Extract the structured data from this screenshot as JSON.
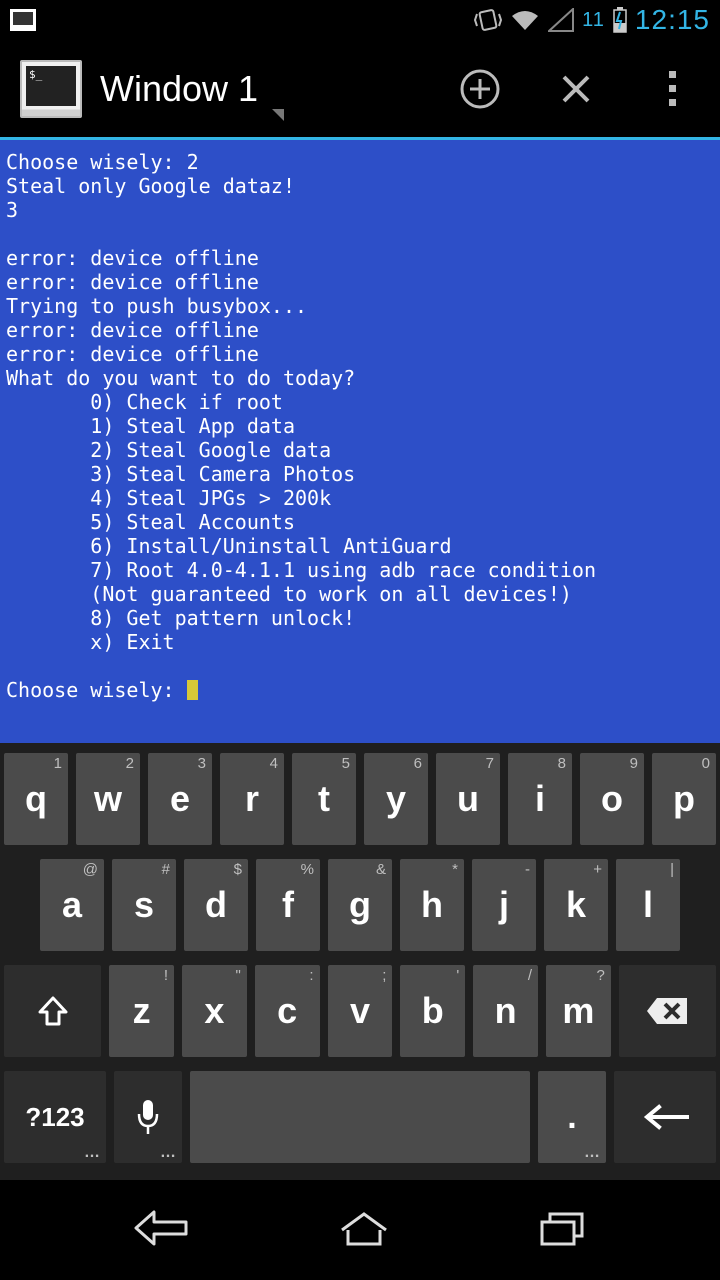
{
  "status": {
    "signal_text": "11",
    "time": "12:15"
  },
  "header": {
    "title": "Window 1"
  },
  "terminal": {
    "lines": [
      "Choose wisely: 2",
      "Steal only Google dataz!",
      "3",
      "",
      "error: device offline",
      "error: device offline",
      "Trying to push busybox...",
      "error: device offline",
      "error: device offline",
      "What do you want to do today?",
      "       0) Check if root",
      "       1) Steal App data",
      "       2) Steal Google data",
      "       3) Steal Camera Photos",
      "       4) Steal JPGs > 200k",
      "       5) Steal Accounts",
      "       6) Install/Uninstall AntiGuard",
      "       7) Root 4.0-4.1.1 using adb race condition",
      "       (Not guaranteed to work on all devices!)",
      "       8) Get pattern unlock!",
      "       x) Exit",
      ""
    ],
    "prompt": "Choose wisely: "
  },
  "keyboard": {
    "row1": [
      {
        "k": "q",
        "s": "1"
      },
      {
        "k": "w",
        "s": "2"
      },
      {
        "k": "e",
        "s": "3"
      },
      {
        "k": "r",
        "s": "4"
      },
      {
        "k": "t",
        "s": "5"
      },
      {
        "k": "y",
        "s": "6"
      },
      {
        "k": "u",
        "s": "7"
      },
      {
        "k": "i",
        "s": "8"
      },
      {
        "k": "o",
        "s": "9"
      },
      {
        "k": "p",
        "s": "0"
      }
    ],
    "row2": [
      {
        "k": "a",
        "s": "@"
      },
      {
        "k": "s",
        "s": "#"
      },
      {
        "k": "d",
        "s": "$"
      },
      {
        "k": "f",
        "s": "%"
      },
      {
        "k": "g",
        "s": "&"
      },
      {
        "k": "h",
        "s": "*"
      },
      {
        "k": "j",
        "s": "-"
      },
      {
        "k": "k",
        "s": "+"
      },
      {
        "k": "l",
        "s": "|"
      }
    ],
    "row3": [
      {
        "k": "z",
        "s": "!"
      },
      {
        "k": "x",
        "s": "\""
      },
      {
        "k": "c",
        "s": ":"
      },
      {
        "k": "v",
        "s": ";"
      },
      {
        "k": "b",
        "s": "'"
      },
      {
        "k": "n",
        "s": "/"
      },
      {
        "k": "m",
        "s": "?"
      }
    ],
    "sym_label": "?123",
    "period": "."
  }
}
